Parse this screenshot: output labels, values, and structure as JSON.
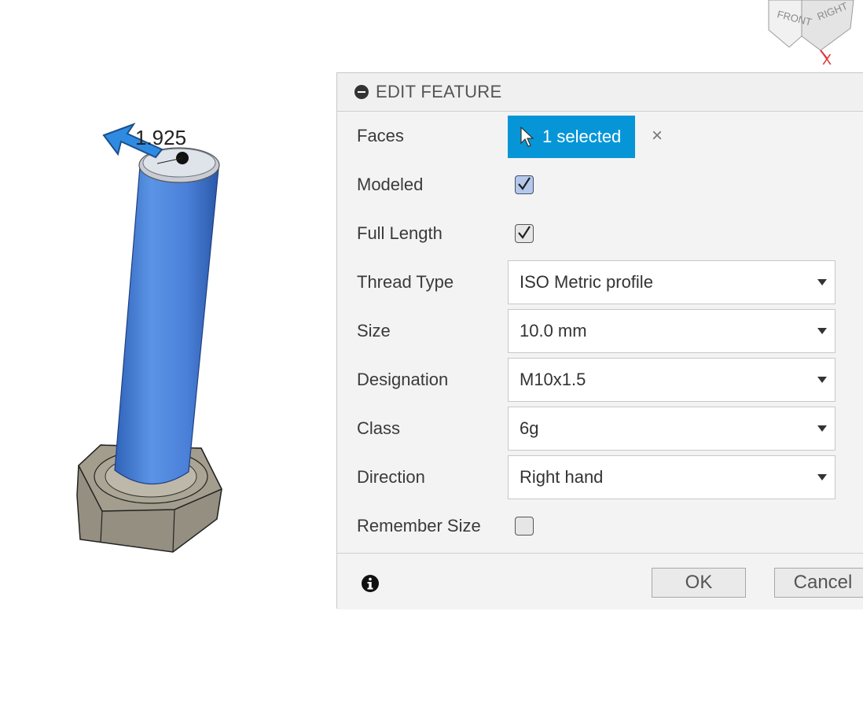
{
  "viewport": {
    "dimension_value": "1.925",
    "viewcube_faces": {
      "front": "FRONT",
      "right": "RIGHT"
    },
    "axis_label": "X",
    "colors": {
      "thread_blue": "#4a86e0",
      "nut_gray": "#8f8a7d"
    }
  },
  "panel": {
    "title": "EDIT FEATURE",
    "faces": {
      "label": "Faces",
      "button_label": "1 selected",
      "clear": "×"
    },
    "modeled": {
      "label": "Modeled",
      "checked": true
    },
    "full_length": {
      "label": "Full Length",
      "checked": true
    },
    "thread_type": {
      "label": "Thread Type",
      "value": "ISO Metric profile"
    },
    "size": {
      "label": "Size",
      "value": "10.0 mm"
    },
    "designation": {
      "label": "Designation",
      "value": "M10x1.5"
    },
    "class": {
      "label": "Class",
      "value": "6g"
    },
    "direction": {
      "label": "Direction",
      "value": "Right hand"
    },
    "remember_size": {
      "label": "Remember Size",
      "checked": false
    },
    "ok_label": "OK",
    "cancel_label": "Cancel"
  },
  "colors": {
    "accent": "#0696d7"
  }
}
